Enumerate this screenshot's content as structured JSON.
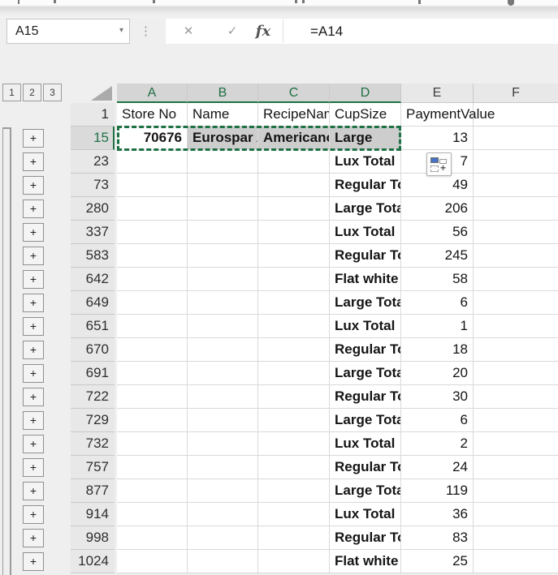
{
  "formula_bar": {
    "name_box_value": "A15",
    "formula": "=A14",
    "fx_label": "fx",
    "cancel_glyph": "✕",
    "enter_glyph": "✓",
    "dots_glyph": "⋮",
    "dropdown_glyph": "▾"
  },
  "outline": {
    "level_buttons": [
      "1",
      "2",
      "3"
    ],
    "collapse_glyph": "+"
  },
  "columns": [
    {
      "letter": "A",
      "selected": true
    },
    {
      "letter": "B",
      "selected": true
    },
    {
      "letter": "C",
      "selected": true
    },
    {
      "letter": "D",
      "selected": true
    },
    {
      "letter": "E",
      "selected": false
    },
    {
      "letter": "F",
      "selected": false
    }
  ],
  "header_row": {
    "row": "1",
    "cells": {
      "a": "Store No",
      "b": "Name",
      "c": "RecipeNam",
      "d": "CupSize",
      "e": "PaymentValue"
    }
  },
  "rows": [
    {
      "row": "15",
      "a": "70676",
      "b": "Eurospar A",
      "c": "Americano",
      "d": "Large",
      "e": "13",
      "selected": true,
      "plus_button": true
    },
    {
      "row": "23",
      "d": "Lux Total",
      "e": "7",
      "plus_button": true
    },
    {
      "row": "73",
      "d": "Regular To",
      "e": "49",
      "plus_button": true
    },
    {
      "row": "280",
      "d": "Large Tota",
      "e": "206",
      "plus_button": true
    },
    {
      "row": "337",
      "d": "Lux Total",
      "e": "56",
      "plus_button": true
    },
    {
      "row": "583",
      "d": "Regular To",
      "e": "245",
      "plus_button": true
    },
    {
      "row": "642",
      "d": "Flat white",
      "e": "58",
      "plus_button": true
    },
    {
      "row": "649",
      "d": "Large Tota",
      "e": "6",
      "plus_button": true
    },
    {
      "row": "651",
      "d": "Lux Total",
      "e": "1",
      "plus_button": true
    },
    {
      "row": "670",
      "d": "Regular To",
      "e": "18",
      "plus_button": true
    },
    {
      "row": "691",
      "d": "Large Tota",
      "e": "20",
      "plus_button": true
    },
    {
      "row": "722",
      "d": "Regular To",
      "e": "30",
      "plus_button": true
    },
    {
      "row": "729",
      "d": "Large Tota",
      "e": "6",
      "plus_button": true
    },
    {
      "row": "732",
      "d": "Lux Total",
      "e": "2",
      "plus_button": true
    },
    {
      "row": "757",
      "d": "Regular To",
      "e": "24",
      "plus_button": true
    },
    {
      "row": "877",
      "d": "Large Tota",
      "e": "119",
      "plus_button": true
    },
    {
      "row": "914",
      "d": "Lux Total",
      "e": "36",
      "plus_button": true
    },
    {
      "row": "998",
      "d": "Regular To",
      "e": "83",
      "plus_button": true
    },
    {
      "row": "1024",
      "d": "Flat white",
      "e": "25",
      "plus_button": true
    }
  ],
  "colors": {
    "accent_green": "#1e7145",
    "header_text_green": "#1f6e43",
    "selected_header_fill": "#d5d5d5",
    "header_fill": "#e8e8e8",
    "selection_fill": "#cdcdcd",
    "gridline": "#d9d9d9",
    "paste_icon_blue": "#4472c4",
    "window_bg": "#f0efef"
  }
}
